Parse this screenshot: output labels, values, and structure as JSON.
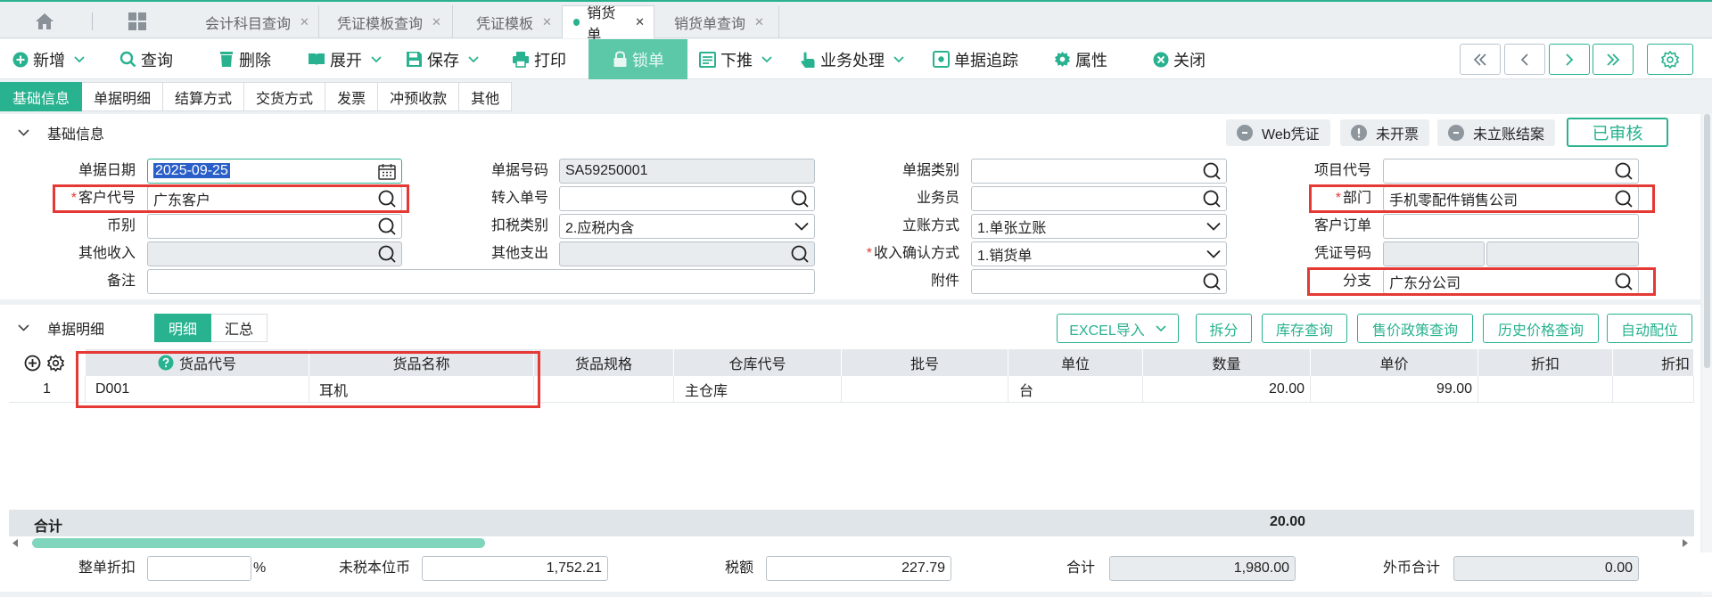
{
  "tabs": [
    {
      "label": "会计科目查询",
      "active": false
    },
    {
      "label": "凭证模板查询",
      "active": false
    },
    {
      "label": "凭证模板",
      "active": false
    },
    {
      "label": "销货单",
      "active": true
    },
    {
      "label": "销货单查询",
      "active": false
    }
  ],
  "toolbar": {
    "add": "新增",
    "query": "查询",
    "delete": "删除",
    "expand": "展开",
    "save": "保存",
    "print": "打印",
    "lock": "锁单",
    "push_down": "下推",
    "business": "业务处理",
    "trace": "单据追踪",
    "properties": "属性",
    "close": "关闭"
  },
  "subtabs": [
    "基础信息",
    "单据明细",
    "结算方式",
    "交货方式",
    "发票",
    "冲预收款",
    "其他"
  ],
  "basic": {
    "title": "基础信息",
    "pill_web": "Web凭证",
    "pill_invoice": "未开票",
    "pill_settle": "未立账结案",
    "approved": "已审核",
    "f_date_label": "单据日期",
    "f_date_value": "2025-09-25",
    "f_customer_label": "客户代号",
    "f_customer_value": "广东客户",
    "f_currency_label": "币别",
    "f_currency_value": "",
    "f_other_income_label": "其他收入",
    "f_remark_label": "备注",
    "f_docno_label": "单据号码",
    "f_docno_value": "SA59250001",
    "f_transfer_label": "转入单号",
    "f_tax_label": "扣税类别",
    "f_tax_value": "2.应税内含",
    "f_other_exp_label": "其他支出",
    "f_doctype_label": "单据类别",
    "f_salesman_label": "业务员",
    "f_account_label": "立账方式",
    "f_account_value": "1.单张立账",
    "f_income_confirm_label": "收入确认方式",
    "f_income_confirm_value": "1.销货单",
    "f_attach_label": "附件",
    "f_project_label": "项目代号",
    "f_dept_label": "部门",
    "f_dept_value": "手机零配件销售公司",
    "f_cust_order_label": "客户订单",
    "f_voucher_label": "凭证号码",
    "f_branch_label": "分支",
    "f_branch_value": "广东分公司"
  },
  "detail": {
    "title": "单据明细",
    "seg_detail": "明细",
    "seg_summary": "汇总",
    "buttons": [
      "EXCEL导入",
      "拆分",
      "库存查询",
      "售价政策查询",
      "历史价格查询",
      "自动配位"
    ],
    "columns": [
      "货品代号",
      "货品名称",
      "货品规格",
      "仓库代号",
      "批号",
      "单位",
      "数量",
      "单价",
      "折扣",
      "折扣"
    ],
    "rows": [
      {
        "no": "1",
        "code": "D001",
        "name": "耳机",
        "spec": "",
        "warehouse": "主仓库",
        "batch": "",
        "unit": "台",
        "qty": "20.00",
        "price": "99.00",
        "discount": ""
      }
    ],
    "sum_label": "合计",
    "sum_qty": "20.00"
  },
  "footer": {
    "discount_label": "整单折扣",
    "discount_value": "",
    "percent": "%",
    "untaxed_label": "未税本位币",
    "untaxed_value": "1,752.21",
    "tax_label": "税额",
    "tax_value": "227.79",
    "total_label": "合计",
    "total_value": "1,980.00",
    "foreign_label": "外币合计",
    "foreign_value": "0.00"
  }
}
